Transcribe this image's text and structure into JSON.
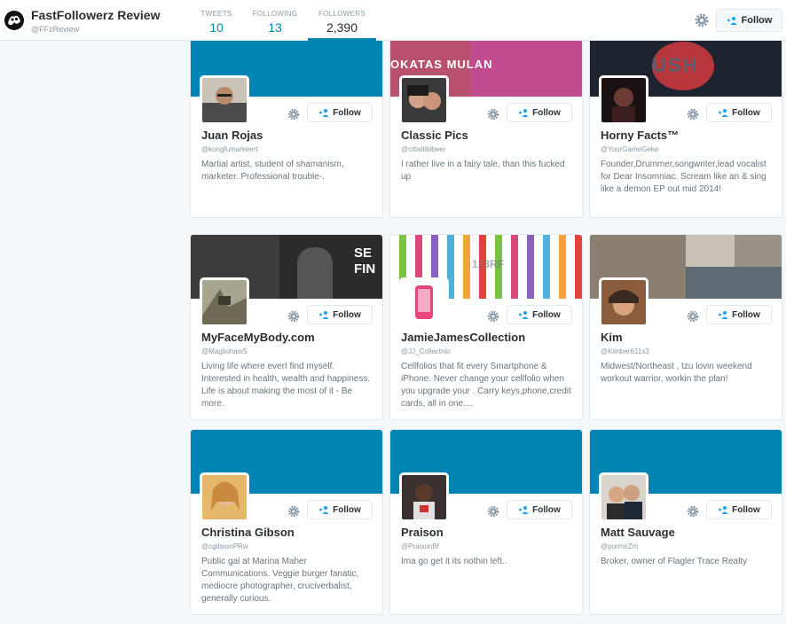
{
  "header": {
    "brand_name": "FastFollowerz Review",
    "brand_handle": "@FFzReview",
    "stats": {
      "tweets_label": "TWEETS",
      "tweets_value": "10",
      "following_label": "FOLLOWING",
      "following_value": "13",
      "followers_label": "FOLLOWERS",
      "followers_value": "2,390"
    },
    "follow_label": "Follow"
  },
  "cards": [
    {
      "name": "Juan Rojas",
      "handle": "@kungfumarkeert",
      "bio": "Martial artist, student of shamanism, marketer. Professional trouble-.",
      "follow": "Follow"
    },
    {
      "name": "Classic Pics",
      "handle": "@citlatlibibeer",
      "bio": "I rather live in a fairy tale, than this fucked up",
      "follow": "Follow"
    },
    {
      "name": "Horny Facts™",
      "handle": "@YourGameGeke",
      "bio": "Founder,Drummer,songwriter,lead vocalist for Dear Insomniac. Scream like an & sing like a demon EP out mid 2014!",
      "follow": "Follow"
    },
    {
      "name": "MyFaceMyBody.com",
      "handle": "@MagliohawS",
      "bio": "Living life where everI find myself. Interested in health, wealth and happiness. Life is about making the most of it - Be more.",
      "follow": "Follow"
    },
    {
      "name": "JamieJamesCollection",
      "handle": "@JJ_Collectnio",
      "bio": "Cellfolios that fit every Smartphone & iPhone. Never change your cellfolio when you upgrade your . Carry keys,phone,credit cards, all in one....",
      "follow": "Follow"
    },
    {
      "name": "Kim",
      "handle": "@Kimber611x3",
      "bio": "Midwest/Northeast , tzu lovin weekend workout warrior, workin the plan!",
      "follow": "Follow"
    },
    {
      "name": "Christina Gibson",
      "handle": "@cgibsonPRw",
      "bio": "Public gal at Marina Maher Communications. Veggie burger fanatic, mediocre photographer, cruciverbalist, generally curious.",
      "follow": "Follow"
    },
    {
      "name": "Praison",
      "handle": "@PraisonBf",
      "bio": "Ima go get it its nothin left..",
      "follow": "Follow"
    },
    {
      "name": "Matt Sauvage",
      "handle": "@pormirZm",
      "bio": "Broker, owner of Flagler Trace Realty",
      "follow": "Follow"
    }
  ],
  "banner_texts": {
    "card2": "OKATAS MULAN",
    "card3": "USH",
    "card4": "SE FIN",
    "card5": "123RF"
  },
  "colors": {
    "accent": "#0084b4",
    "text": "#292f33",
    "muted": "#8899a6",
    "bio": "#66757f",
    "page_bg": "#f5f8fa",
    "border": "#e1e8ed"
  },
  "icons": {
    "gear": "gear-icon",
    "follow": "add-person-icon",
    "logo": "brand-logo-icon"
  }
}
